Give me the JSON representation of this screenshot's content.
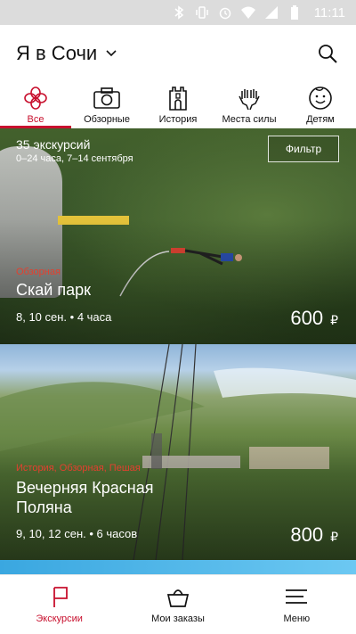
{
  "status_bar": {
    "time": "11:11"
  },
  "header": {
    "title": "Я в Сочи"
  },
  "tabs": [
    {
      "label": "Все",
      "icon": "flower-icon",
      "active": true
    },
    {
      "label": "Обзорные",
      "icon": "camera-icon",
      "active": false
    },
    {
      "label": "История",
      "icon": "tower-icon",
      "active": false
    },
    {
      "label": "Места силы",
      "icon": "hands-icon",
      "active": false
    },
    {
      "label": "Детям",
      "icon": "child-face-icon",
      "active": false
    }
  ],
  "feed": {
    "count": "35 экскурсий",
    "dates": "0–24 часа, 7–14 сентября",
    "filter_label": "Фильтр"
  },
  "tours": [
    {
      "category": "Обзорная",
      "title": "Скай парк",
      "meta": "8, 10 сен. • 4 часа",
      "price": "600",
      "currency": "₽"
    },
    {
      "category": "История, Обзорная, Пешая",
      "title_line1": "Вечерняя Красная",
      "title_line2": "Поляна",
      "meta": "9, 10, 12 сен. • 6 часов",
      "price": "800",
      "currency": "₽"
    }
  ],
  "bottom_nav": [
    {
      "label": "Экскурсии",
      "icon": "flag-icon",
      "active": true
    },
    {
      "label": "Мои заказы",
      "icon": "basket-icon",
      "active": false
    },
    {
      "label": "Меню",
      "icon": "menu-icon",
      "active": false
    }
  ],
  "colors": {
    "accent": "#c8102e",
    "category": "#e3402f"
  }
}
